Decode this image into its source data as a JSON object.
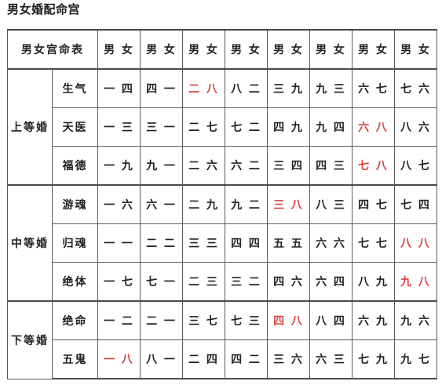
{
  "title": "男女婚配命宫",
  "colors": {
    "highlight": "#d8423f",
    "text": "#231f20",
    "border": "#5a5a5a"
  },
  "table": {
    "header": {
      "corner_label": "男女宫命表",
      "pair_labels": [
        "男 女",
        "男 女",
        "男 女",
        "男 女",
        "男 女",
        "男 女",
        "男 女",
        "男 女"
      ]
    },
    "groups": [
      {
        "label": "上等婚",
        "rows": [
          {
            "name": "生气",
            "pairs": [
              "一 四",
              "四 一",
              "二 八",
              "八 二",
              "三 九",
              "九 三",
              "六 七",
              "七 六"
            ],
            "highlight_index": 2
          },
          {
            "name": "天医",
            "pairs": [
              "一 三",
              "三 一",
              "二 七",
              "七 二",
              "四 九",
              "九 四",
              "六 八",
              "八 六"
            ],
            "highlight_index": 6
          },
          {
            "name": "福德",
            "pairs": [
              "一 九",
              "九 一",
              "二 六",
              "六 二",
              "三 四",
              "四 三",
              "七 八",
              "八 七"
            ],
            "highlight_index": 6
          }
        ]
      },
      {
        "label": "中等婚",
        "rows": [
          {
            "name": "游魂",
            "pairs": [
              "一 六",
              "六 一",
              "二 九",
              "九 二",
              "三 八",
              "八 三",
              "四 七",
              "七 四"
            ],
            "highlight_index": 4
          },
          {
            "name": "归魂",
            "pairs": [
              "一 一",
              "二 二",
              "三 三",
              "四 四",
              "五 五",
              "六 六",
              "七 七",
              "八 八"
            ],
            "highlight_index": 7
          },
          {
            "name": "绝体",
            "pairs": [
              "一 七",
              "七 一",
              "二 三",
              "三 二",
              "四 六",
              "六 四",
              "八 九",
              "九 八"
            ],
            "highlight_index": 7
          }
        ]
      },
      {
        "label": "下等婚",
        "rows": [
          {
            "name": "绝命",
            "pairs": [
              "一 二",
              "二 一",
              "三 七",
              "七 三",
              "四 八",
              "八 四",
              "六 九",
              "九 六"
            ],
            "highlight_index": 4
          },
          {
            "name": "五鬼",
            "pairs": [
              "一 八",
              "八 一",
              "二 四",
              "四 二",
              "三 六",
              "六 三",
              "七 九",
              "九 七"
            ],
            "highlight_index": 0
          }
        ]
      }
    ]
  }
}
